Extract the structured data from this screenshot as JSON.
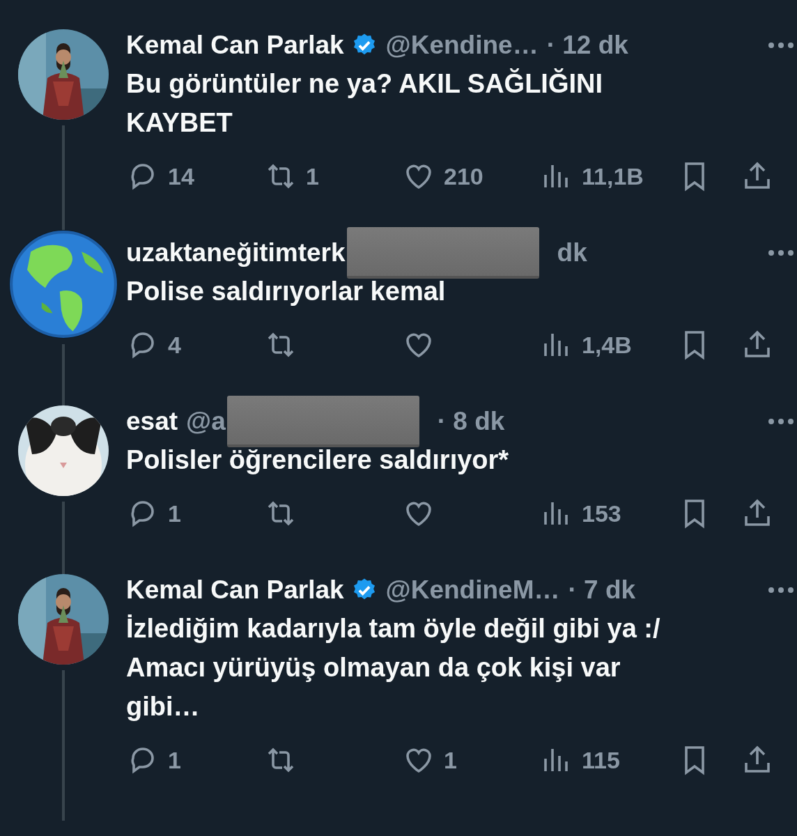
{
  "tweets": [
    {
      "name": "Kemal Can Parlak",
      "verified": true,
      "handle": "@Kendine…",
      "redacted": false,
      "time": "· 12 dk",
      "text": "Bu görüntüler ne ya? AKIL SAĞLIĞINI KAYBET",
      "stats": {
        "replies": "14",
        "retweets": "1",
        "likes": "210",
        "views": "11,1B"
      }
    },
    {
      "name": "uzaktaneğitimterk",
      "verified": false,
      "redacted": true,
      "time": "dk",
      "text": "Polise saldırıyorlar kemal",
      "stats": {
        "replies": "4",
        "views": "1,4B"
      }
    },
    {
      "name": "esat",
      "verified": false,
      "handle": "@a",
      "redacted": true,
      "time": "· 8 dk",
      "text": "Polisler öğrencilere saldırıyor*",
      "stats": {
        "replies": "1",
        "views": "153"
      }
    },
    {
      "name": "Kemal Can Parlak",
      "verified": true,
      "handle": "@KendineM…",
      "redacted": false,
      "time": "· 7 dk",
      "text": "İzlediğim kadarıyla tam öyle değil gibi ya :/ Amacı yürüyüş olmayan da çok kişi var gibi…",
      "stats": {
        "replies": "1",
        "likes": "1",
        "views": "115"
      }
    }
  ]
}
